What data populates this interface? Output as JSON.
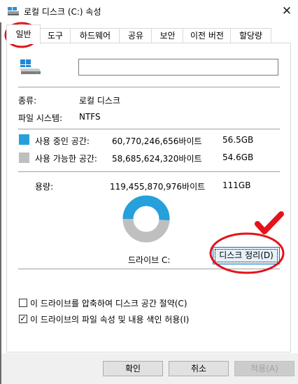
{
  "window": {
    "title": "로컬 디스크 (C:) 속성",
    "close_glyph": "✕"
  },
  "tabs": [
    {
      "label": "일반",
      "active": true
    },
    {
      "label": "도구",
      "active": false
    },
    {
      "label": "하드웨어",
      "active": false
    },
    {
      "label": "공유",
      "active": false
    },
    {
      "label": "보안",
      "active": false
    },
    {
      "label": "이전 버전",
      "active": false
    },
    {
      "label": "할당량",
      "active": false
    }
  ],
  "drive": {
    "name_value": "",
    "icon": "drive-icon",
    "type_label": "종류:",
    "type_value": "로컬 디스크",
    "fs_label": "파일 시스템:",
    "fs_value": "NTFS"
  },
  "space": {
    "used_label": "사용 중인 공간:",
    "used_bytes": "60,770,246,656바이트",
    "used_size": "56.5GB",
    "used_color": "#26a0da",
    "free_label": "사용 가능한 공간:",
    "free_bytes": "58,685,624,320바이트",
    "free_size": "54.6GB",
    "free_color": "#bfbfbf",
    "capacity_label": "용량:",
    "capacity_bytes": "119,455,870,976바이트",
    "capacity_size": "111GB",
    "used_fraction": 0.5087
  },
  "drive_label": "드라이브 C:",
  "cleanup_button": "디스크 정리(D)",
  "options": {
    "compress_label": "이 드라이브를 압축하여 디스크 공간 절약(C)",
    "compress_checked": false,
    "index_label": "이 드라이브의 파일 속성 및 내용 색인 허용(I)",
    "index_checked": true
  },
  "buttons": {
    "ok": "확인",
    "cancel": "취소",
    "apply": "적용(A)"
  },
  "annotations": {
    "highlight_color": "#e3131b",
    "checkmark": "checkmark-icon"
  }
}
